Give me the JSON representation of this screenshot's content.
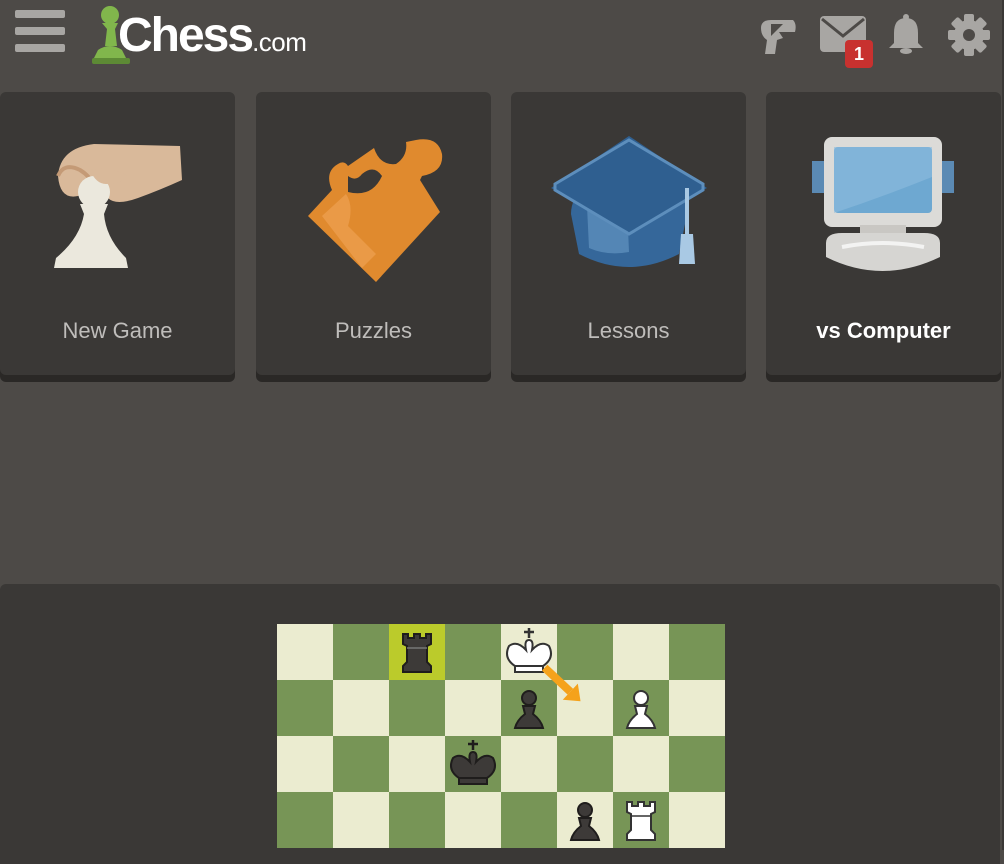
{
  "header": {
    "logo_text_main": "Chess",
    "logo_text_suffix": ".com",
    "menu_icon": "hamburger-menu-icon",
    "icons": [
      "play-bishop-icon",
      "envelope-icon",
      "bell-icon",
      "gear-icon"
    ],
    "messages_badge": "1",
    "badge_color": "#c8312f"
  },
  "tiles": [
    {
      "label": "New Game",
      "icon": "hand-pawn-icon"
    },
    {
      "label": "Puzzles",
      "icon": "puzzle-piece-icon"
    },
    {
      "label": "Lessons",
      "icon": "graduation-cap-icon"
    },
    {
      "label": "vs Computer",
      "icon": "computer-icon"
    }
  ],
  "board": {
    "light_square": "#ebecd0",
    "dark_square": "#779556",
    "highlight_square": "#bbcb2b",
    "arrow_color": "#f5a21b",
    "highlight": "c8",
    "arrow": {
      "from": "e8",
      "to": "f7"
    },
    "pieces": [
      {
        "square": "c8",
        "piece": "black-rook"
      },
      {
        "square": "e8",
        "piece": "white-king"
      },
      {
        "square": "e7",
        "piece": "black-pawn"
      },
      {
        "square": "g7",
        "piece": "white-pawn"
      },
      {
        "square": "d6",
        "piece": "black-king"
      },
      {
        "square": "f5",
        "piece": "black-pawn"
      },
      {
        "square": "g5",
        "piece": "white-rook"
      }
    ]
  },
  "colors": {
    "background": "#4d4a47",
    "tile": "#3a3836",
    "accent_green": "#81b64c"
  }
}
